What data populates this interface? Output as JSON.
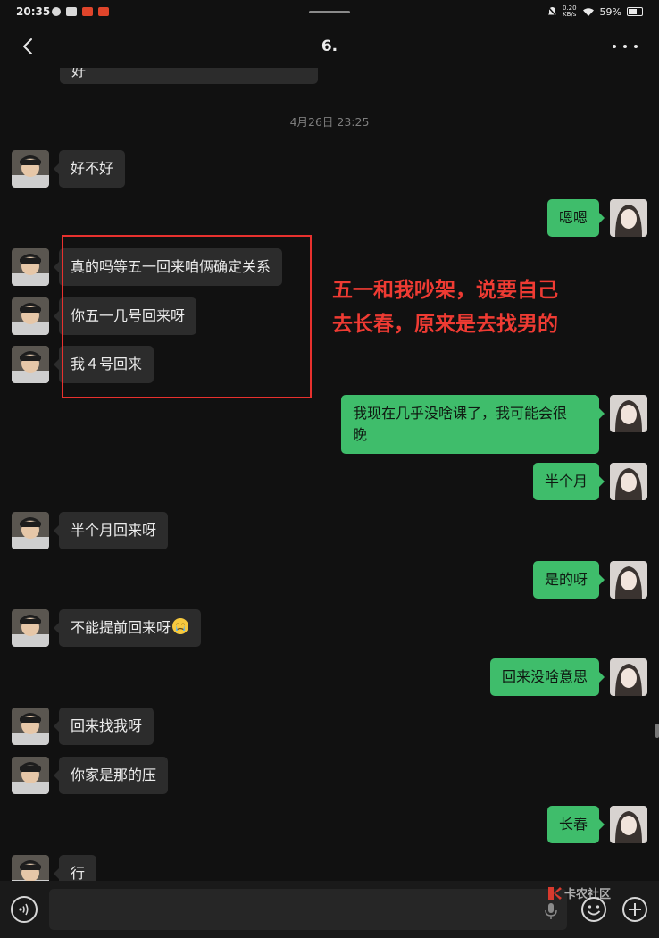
{
  "status_bar": {
    "time": "20:35",
    "net_speed_value": "0.20",
    "net_speed_unit": "KB/s",
    "battery": "59%"
  },
  "nav": {
    "title": "6."
  },
  "chat": {
    "partial_message": "好",
    "timestamp": "4月26日 23:25",
    "messages": [
      {
        "side": "in",
        "text": "好不好"
      },
      {
        "side": "out",
        "text": "嗯嗯"
      },
      {
        "side": "in",
        "text": "真的吗等五一回来咱俩确定关系"
      },
      {
        "side": "in",
        "text": "你五一几号回来呀"
      },
      {
        "side": "in",
        "text": "我４号回来"
      },
      {
        "side": "out",
        "text": "我现在几乎没啥课了，我可能会很\n晚"
      },
      {
        "side": "out",
        "text": "半个月"
      },
      {
        "side": "in",
        "text": "半个月回来呀"
      },
      {
        "side": "out",
        "text": "是的呀"
      },
      {
        "side": "in",
        "text": "不能提前回来呀"
      },
      {
        "side": "out",
        "text": "回来没啥意思"
      },
      {
        "side": "in",
        "text": "回来找我呀"
      },
      {
        "side": "in",
        "text": "你家是那的压"
      },
      {
        "side": "out",
        "text": "长春"
      },
      {
        "side": "in",
        "text": "行"
      }
    ]
  },
  "annotation": {
    "line1": "五一和我吵架，说要自己",
    "line2": "去长春，原来是去找男的",
    "color": "#ef3b33"
  },
  "input_bar": {
    "placeholder": "",
    "watermark": "卡农社区"
  },
  "colors": {
    "background": "#111111",
    "incoming_bubble": "#2c2c2c",
    "outgoing_bubble": "#3fbd6b",
    "annotation_border": "#e8312e"
  },
  "icons": {
    "back": "chevron-left-icon",
    "more": "more-dots-icon",
    "voice": "voice-icon",
    "emoji": "emoji-icon",
    "plus": "plus-icon"
  }
}
